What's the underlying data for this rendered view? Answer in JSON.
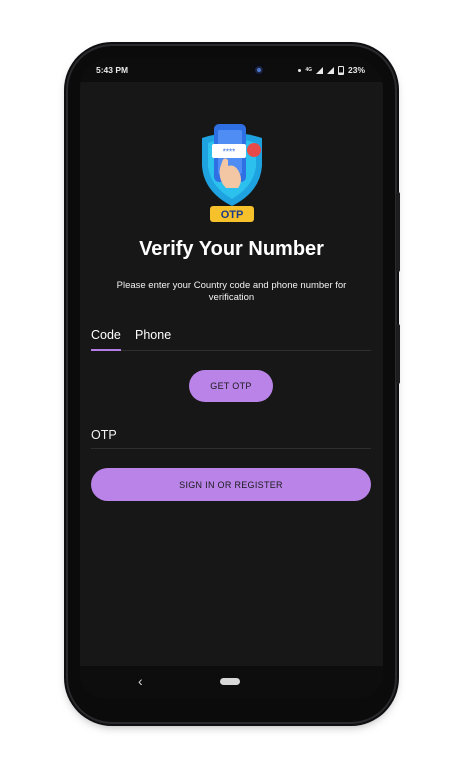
{
  "status_bar": {
    "time": "5:43 PM",
    "network": "4G",
    "battery": "23%"
  },
  "logo": {
    "badge_text": "OTP",
    "code_mask": "****"
  },
  "header": {
    "title": "Verify Your Number",
    "subtitle": "Please enter your Country code  and phone number for verification"
  },
  "form": {
    "tabs": [
      {
        "label": "Code"
      },
      {
        "label": "Phone"
      }
    ],
    "get_otp_label": "GET OTP",
    "otp_placeholder": "OTP",
    "sign_in_label": "SIGN IN OR REGISTER"
  },
  "nav": {
    "back_symbol": "‹"
  },
  "colors": {
    "accent": "#b983e8",
    "background": "#171717",
    "text": "#ffffff"
  }
}
